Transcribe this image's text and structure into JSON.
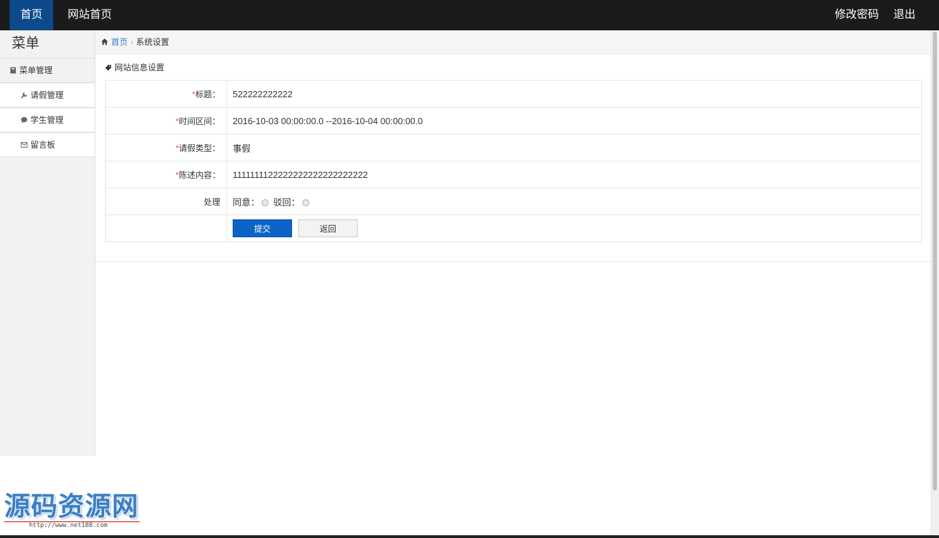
{
  "topbar": {
    "home": "首页",
    "site_home": "网站首页",
    "change_password": "修改密码",
    "logout": "退出"
  },
  "sidebar": {
    "title": "菜单",
    "group": "菜单管理",
    "items": [
      {
        "label": "请假管理",
        "icon": "wrench-icon"
      },
      {
        "label": "学生管理",
        "icon": "chat-icon"
      },
      {
        "label": "留言板",
        "icon": "envelope-icon"
      }
    ]
  },
  "breadcrumb": {
    "home": "首页",
    "current": "系统设置"
  },
  "panel": {
    "title": "网站信息设置"
  },
  "form": {
    "rows": [
      {
        "label": "标题：",
        "value": "522222222222",
        "required": true
      },
      {
        "label": "时间区间：",
        "value": "2016-10-03 00:00:00.0 --2016-10-04 00:00:00.0",
        "required": true
      },
      {
        "label": "请假类型：",
        "value": "事假",
        "required": true
      },
      {
        "label": "陈述内容：",
        "value": "1111111122222222222222222222",
        "required": true
      }
    ],
    "process_label": "处理",
    "agree_label": "同意：",
    "reject_label": "驳回：",
    "submit": "提交",
    "back": "返回"
  },
  "watermark": {
    "text": "源码资源网",
    "url": "http://www.net188.com"
  },
  "colors": {
    "topbar": "#1b1b1b",
    "active_nav": "#0c4a8c",
    "primary_button": "#0b63c6",
    "required_mark": "#e4562a"
  }
}
